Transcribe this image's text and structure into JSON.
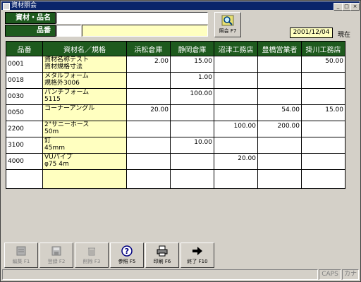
{
  "window": {
    "title": "資材照会"
  },
  "form": {
    "material_label": "資材・品名",
    "code_label": "品番",
    "material_value": "",
    "code_value": "",
    "code_name_value": ""
  },
  "query_button": {
    "label": "照会 F7",
    "icon": "search-magnifier-icon"
  },
  "date": "2001/12/04",
  "date_suffix": "現在",
  "table": {
    "headers": [
      "品番",
      "資材名／規格",
      "浜松倉庫",
      "静岡倉庫",
      "沼津工務店",
      "豊橋営業者",
      "掛川工務店"
    ],
    "rows": [
      {
        "code": "0001",
        "name": "資材名称テスト",
        "spec": "資材規格寸法",
        "values": [
          "2.00",
          "15.00",
          "",
          "",
          "50.00"
        ]
      },
      {
        "code": "0018",
        "name": "メタルフォーム",
        "spec": "規格外3006",
        "values": [
          "",
          "1.00",
          "",
          "",
          ""
        ]
      },
      {
        "code": "0030",
        "name": "パンチフォーム",
        "spec": "5115",
        "values": [
          "",
          "100.00",
          "",
          "",
          ""
        ]
      },
      {
        "code": "0050",
        "name": "コーナーアングル",
        "spec": "",
        "values": [
          "20.00",
          "",
          "",
          "54.00",
          "15.00"
        ]
      },
      {
        "code": "2200",
        "name": "2\"サニーホース",
        "spec": "50m",
        "values": [
          "",
          "",
          "100.00",
          "200.00",
          ""
        ]
      },
      {
        "code": "3100",
        "name": "釘",
        "spec": "45mm",
        "values": [
          "",
          "10.00",
          "",
          "",
          ""
        ]
      },
      {
        "code": "4000",
        "name": "VUパイプ",
        "spec": "φ75 4m",
        "values": [
          "",
          "",
          "20.00",
          "",
          ""
        ]
      },
      {
        "code": "",
        "name": "",
        "spec": "",
        "values": [
          "",
          "",
          "",
          "",
          ""
        ]
      }
    ]
  },
  "buttons": [
    {
      "label": "編集 F1",
      "enabled": false,
      "icon": "edit-icon"
    },
    {
      "label": "登録 F2",
      "enabled": false,
      "icon": "save-disk-icon"
    },
    {
      "label": "削除 F3",
      "enabled": false,
      "icon": "trash-icon"
    },
    {
      "label": "参照 F5",
      "enabled": true,
      "icon": "help-question-icon"
    },
    {
      "label": "印刷 F6",
      "enabled": true,
      "icon": "printer-icon"
    },
    {
      "label": "終了 F10",
      "enabled": true,
      "icon": "exit-arrow-icon"
    }
  ],
  "status": {
    "caps": "CAPS",
    "kana": "カナ"
  }
}
